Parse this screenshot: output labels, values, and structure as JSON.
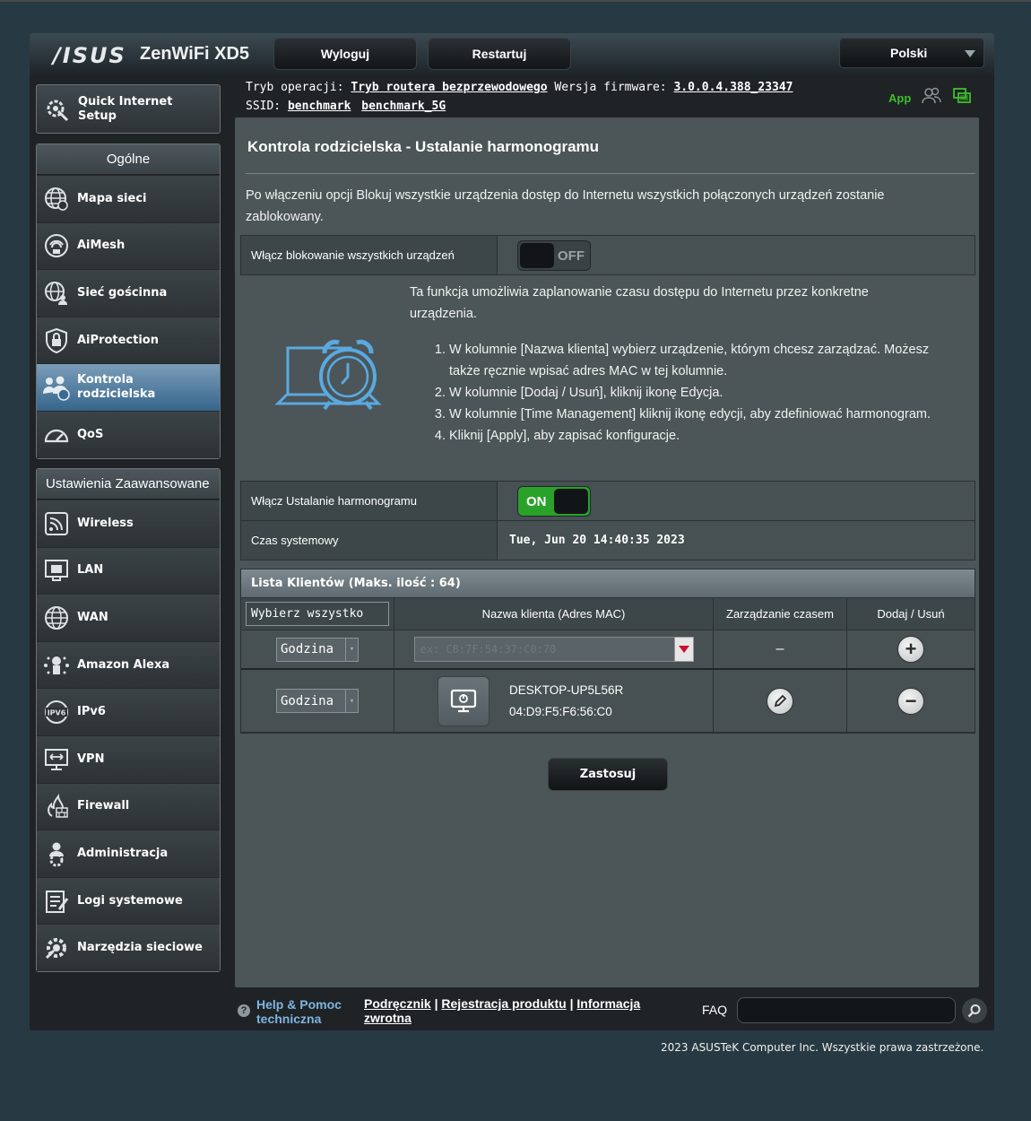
{
  "header": {
    "brand": "/ISUS",
    "model": "ZenWiFi XD5",
    "logout_label": "Wyloguj",
    "restart_label": "Restartuj",
    "language": "Polski"
  },
  "status": {
    "mode_label": "Tryb operacji:",
    "mode_value": "Tryb routera bezprzewodowego",
    "firmware_label": "Wersja firmware:",
    "firmware_value": "3.0.0.4.388_23347",
    "ssid_label": "SSID:",
    "ssid_1": "benchmark",
    "ssid_2": "benchmark_5G",
    "app_label": "App"
  },
  "sidebar": {
    "qis_label_1": "Quick Internet",
    "qis_label_2": "Setup",
    "general_heading": "Ogólne",
    "general_items": [
      {
        "label": "Mapa sieci"
      },
      {
        "label": "AiMesh"
      },
      {
        "label": "Sieć gościnna"
      },
      {
        "label": "AiProtection"
      },
      {
        "label_1": "Kontrola",
        "label_2": "rodzicielska"
      },
      {
        "label": "QoS"
      }
    ],
    "advanced_heading": "Ustawienia Zaawansowane",
    "advanced_items": [
      {
        "label": "Wireless"
      },
      {
        "label": "LAN"
      },
      {
        "label": "WAN"
      },
      {
        "label": "Amazon Alexa"
      },
      {
        "label": "IPv6"
      },
      {
        "label": "VPN"
      },
      {
        "label": "Firewall"
      },
      {
        "label": "Administracja"
      },
      {
        "label": "Logi systemowe"
      },
      {
        "label": "Narzędzia sieciowe"
      }
    ]
  },
  "main": {
    "title": "Kontrola rodzicielska - Ustalanie harmonogramu",
    "description": "Po włączeniu opcji Blokuj wszystkie urządzenia dostęp do Internetu wszystkich połączonych urządzeń zostanie zablokowany.",
    "block_all_label": "Włącz blokowanie wszystkich urządzeń",
    "block_all_state": "OFF",
    "intro": "Ta funkcja umożliwia zaplanowanie czasu dostępu do Internetu przez konkretne urządzenia.",
    "steps": [
      "W kolumnie [Nazwa klienta] wybierz urządzenie, którym chcesz zarządzać. Możesz także ręcznie wpisać adres MAC w tej kolumnie.",
      "W kolumnie [Dodaj / Usuń], kliknij ikonę Edycja.",
      "W kolumnie [Time Management] kliknij ikonę edycji, aby zdefiniować harmonogram.",
      "Kliknij [Apply], aby zapisać konfiguracje."
    ],
    "schedule_label": "Włącz Ustalanie harmonogramu",
    "schedule_state": "ON",
    "system_time_label": "Czas systemowy",
    "system_time_value": "Tue, Jun 20 14:40:35 2023",
    "client_list_title": "Lista Klientów (Maks. ilość : 64)",
    "select_all": "Wybierz wszystko",
    "col_name": "Nazwa klienta (Adres MAC)",
    "col_time": "Zarządzanie czasem",
    "col_addremove": "Dodaj / Usuń",
    "row1_select": "Godzina",
    "mac_placeholder": "ex: C8:7F:54:37:C0:70",
    "row1_time": "–",
    "row2_select": "Godzina",
    "device_name": "DESKTOP-UP5L56R",
    "device_mac": "04:D9:F5:F6:56:C0",
    "apply_label": "Zastosuj"
  },
  "footer": {
    "help_1": "Help & Pomoc",
    "help_2": "techniczna",
    "link_manual": "Podręcznik",
    "sep": "|",
    "link_register": "Rejestracja produktu",
    "link_info_1": "Informacja",
    "link_info_2": "zwrotna",
    "faq_label": "FAQ",
    "copyright": "2023 ASUSTeK Computer Inc. Wszystkie prawa zastrzeżone."
  },
  "colors": {
    "accent_green": "#3dbf2a",
    "active_menu": "#4a7aa3",
    "help_link": "#7fb4e0",
    "page_bg": "#273a44"
  },
  "icons": [
    "parental-clock-icon",
    "desktop-client-icon",
    "edit-pencil-icon",
    "add-plus-icon",
    "remove-minus-icon",
    "search-icon",
    "help-icon"
  ]
}
